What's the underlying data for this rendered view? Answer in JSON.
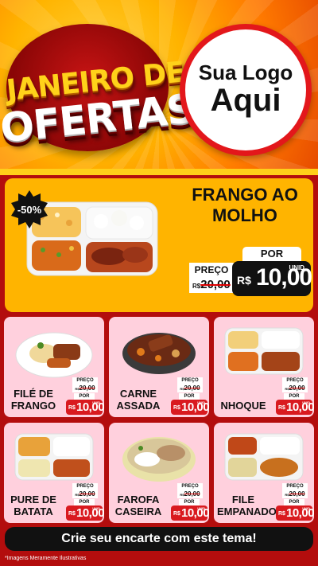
{
  "header": {
    "title_line1": "JANEIRO DE",
    "title_line2": "OFERTAS",
    "logo_line1": "Sua Logo",
    "logo_line2": "Aqui"
  },
  "featured": {
    "discount": "-50%",
    "name": "FRANGO AO MOLHO",
    "preco_label": "PREÇO",
    "old_currency": "R$",
    "old_value": "20,00",
    "por_label": "POR",
    "currency": "R$",
    "price": "10,00",
    "unit": "UNID"
  },
  "cards": [
    {
      "name": "FILÉ DE FRANGO",
      "preco_label": "PREÇO",
      "old_currency": "R$",
      "old_value": "20,00",
      "por_label": "POR",
      "currency": "R$",
      "price": "10,00",
      "unit": "UNID",
      "icon": "grilled-chicken-plate-icon"
    },
    {
      "name": "CARNE ASSADA",
      "preco_label": "PREÇO",
      "old_currency": "R$",
      "old_value": "20,00",
      "por_label": "POR",
      "currency": "R$",
      "price": "10,00",
      "unit": "UNID",
      "icon": "roast-meat-bowl-icon"
    },
    {
      "name": "NHOQUE",
      "preco_label": "PREÇO",
      "old_currency": "R$",
      "old_value": "20,00",
      "por_label": "POR",
      "currency": "R$",
      "price": "10,00",
      "unit": "UNID",
      "icon": "gnocchi-tray-icon"
    },
    {
      "name": "PURE DE BATATA",
      "preco_label": "PREÇO",
      "old_currency": "R$",
      "old_value": "20,00",
      "por_label": "POR",
      "currency": "R$",
      "price": "10,00",
      "unit": "UNID",
      "icon": "mashed-potato-tray-icon"
    },
    {
      "name": "FAROFA CASEIRA",
      "preco_label": "PREÇO",
      "old_currency": "R$",
      "old_value": "20,00",
      "por_label": "POR",
      "currency": "R$",
      "price": "10,00",
      "unit": "UNID",
      "icon": "farofa-bowl-icon"
    },
    {
      "name": "FILE EMPANADO",
      "preco_label": "PREÇO",
      "old_currency": "R$",
      "old_value": "20,00",
      "por_label": "POR",
      "currency": "R$",
      "price": "10,00",
      "unit": "UNID",
      "icon": "breaded-steak-tray-icon"
    }
  ],
  "cta": "Crie seu encarte com este tema!",
  "footnote": "*Imagens Meramente Ilustrativas",
  "colors": {
    "accent_red": "#d91a1f",
    "banner_yellow": "#ffb400",
    "card_pink": "#ffd0dd",
    "price_black": "#111111"
  }
}
